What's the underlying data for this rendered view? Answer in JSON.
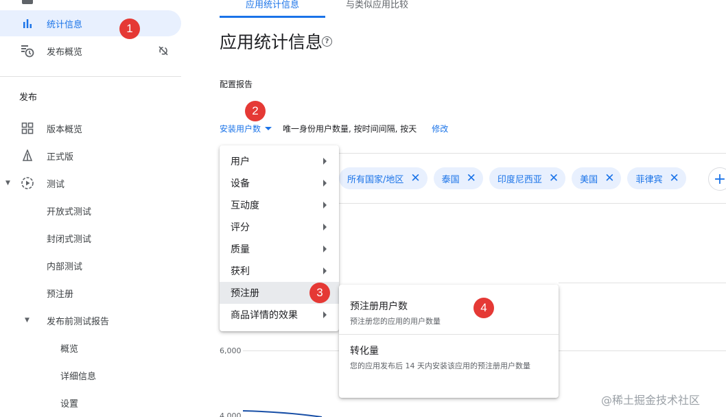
{
  "sidebar": {
    "top_items": [
      {
        "label": "统计信息",
        "icon": "bar-chart-icon",
        "active": true
      },
      {
        "label": "发布概览",
        "icon": "publishing-overview-icon"
      }
    ],
    "section_title": "发布",
    "items": [
      {
        "label": "版本概览",
        "icon": "dashboard-grid-icon"
      },
      {
        "label": "正式版",
        "icon": "production-icon"
      },
      {
        "label": "测试",
        "icon": "testing-play-icon"
      },
      {
        "label": "开放式测试"
      },
      {
        "label": "封闭式测试"
      },
      {
        "label": "内部测试"
      },
      {
        "label": "预注册"
      },
      {
        "label": "发布前测试报告"
      },
      {
        "label": "概览"
      },
      {
        "label": "详细信息"
      },
      {
        "label": "设置"
      }
    ]
  },
  "tabs": [
    {
      "label": "应用统计信息",
      "active": true
    },
    {
      "label": "与类似应用比较",
      "active": false
    }
  ],
  "page_title": "应用统计信息",
  "help_glyph": "?",
  "config_label": "配置报告",
  "metric": {
    "selected": "安装用户数",
    "description": "唯一身份用户数量, 按时间间隔, 按天",
    "edit": "修改"
  },
  "filter_chips": [
    "所有国家/地区",
    "泰国",
    "印度尼西亚",
    "美国",
    "菲律宾"
  ],
  "add_glyph": "+",
  "close_glyph": "✕",
  "chart_axis": {
    "tick_6000": "6,000",
    "tick_4000": "4,000"
  },
  "menu": {
    "items": [
      "用户",
      "设备",
      "互动度",
      "评分",
      "质量",
      "获利",
      "预注册",
      "商品详情的效果"
    ],
    "highlighted_index": 6
  },
  "submenu": {
    "options": [
      {
        "title": "预注册用户数",
        "desc": "预注册您的应用的用户数量"
      },
      {
        "title": "转化量",
        "desc": "您的应用发布后 14 天内安装该应用的预注册用户数量"
      }
    ]
  },
  "badges": [
    "1",
    "2",
    "3",
    "4"
  ],
  "watermark": "@稀土掘金技术社区",
  "colors": {
    "accent": "#1a73e8",
    "badge": "#e53935",
    "active_bg": "#e8f0fe"
  }
}
